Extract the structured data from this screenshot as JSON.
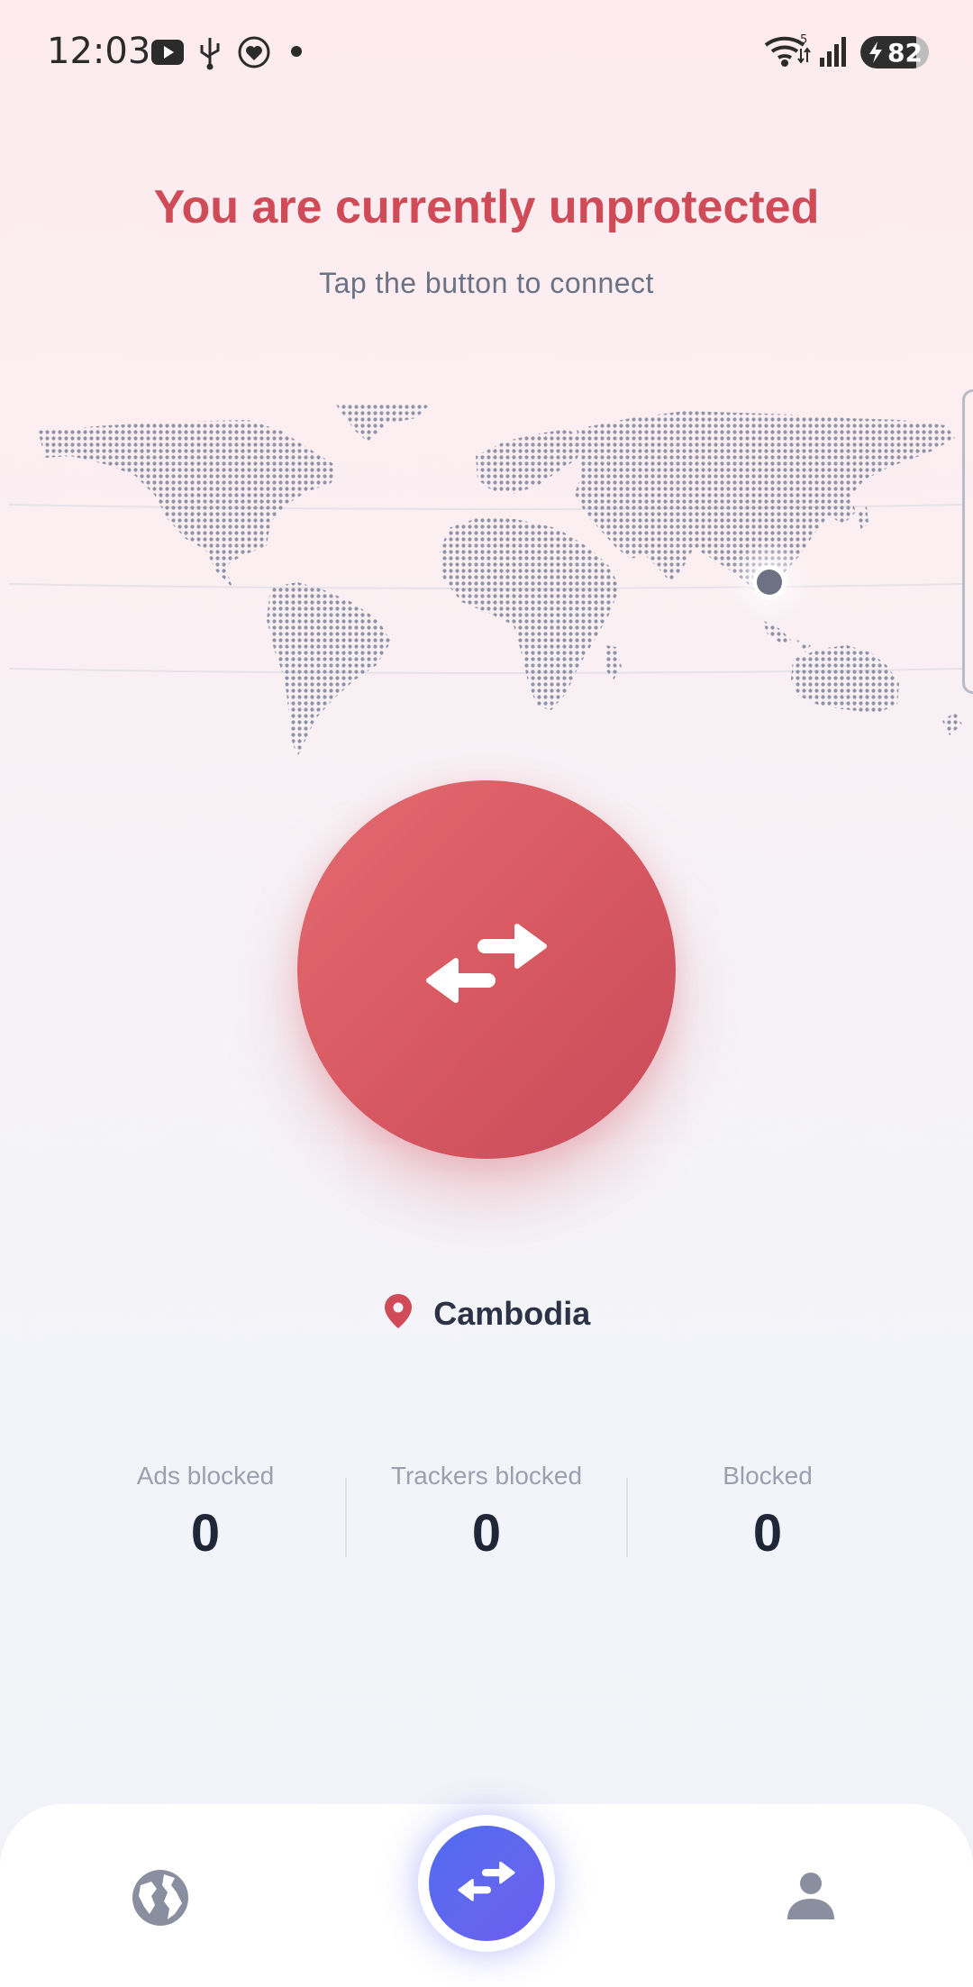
{
  "status_bar": {
    "time": "12:03",
    "battery_level": "82",
    "battery_fraction": 0.82,
    "icons": [
      "youtube-icon",
      "usb-icon",
      "heart-rate-icon",
      "dot-icon",
      "wifi-icon",
      "signal-icon",
      "battery-icon"
    ]
  },
  "header": {
    "title": "You are currently unprotected",
    "subtitle": "Tap the button to connect"
  },
  "map": {
    "selected_location_marker": "location-dot"
  },
  "connect_button": {
    "icon": "swap-arrows-icon",
    "color": "#d85962"
  },
  "location": {
    "icon": "map-pin-icon",
    "name": "Cambodia"
  },
  "stats": [
    {
      "label": "Ads blocked",
      "value": "0"
    },
    {
      "label": "Trackers blocked",
      "value": "0"
    },
    {
      "label": "Blocked",
      "value": "0"
    }
  ],
  "bottom_nav": {
    "items": [
      {
        "name": "globe",
        "icon": "globe-icon"
      },
      {
        "name": "connect",
        "icon": "swap-arrows-icon",
        "color": "#5a63ee"
      },
      {
        "name": "profile",
        "icon": "user-icon"
      }
    ]
  },
  "colors": {
    "accent_red": "#cf4b57",
    "accent_blue": "#5a63ee",
    "text_dark": "#1f2638",
    "text_muted": "#9aa0ae"
  }
}
